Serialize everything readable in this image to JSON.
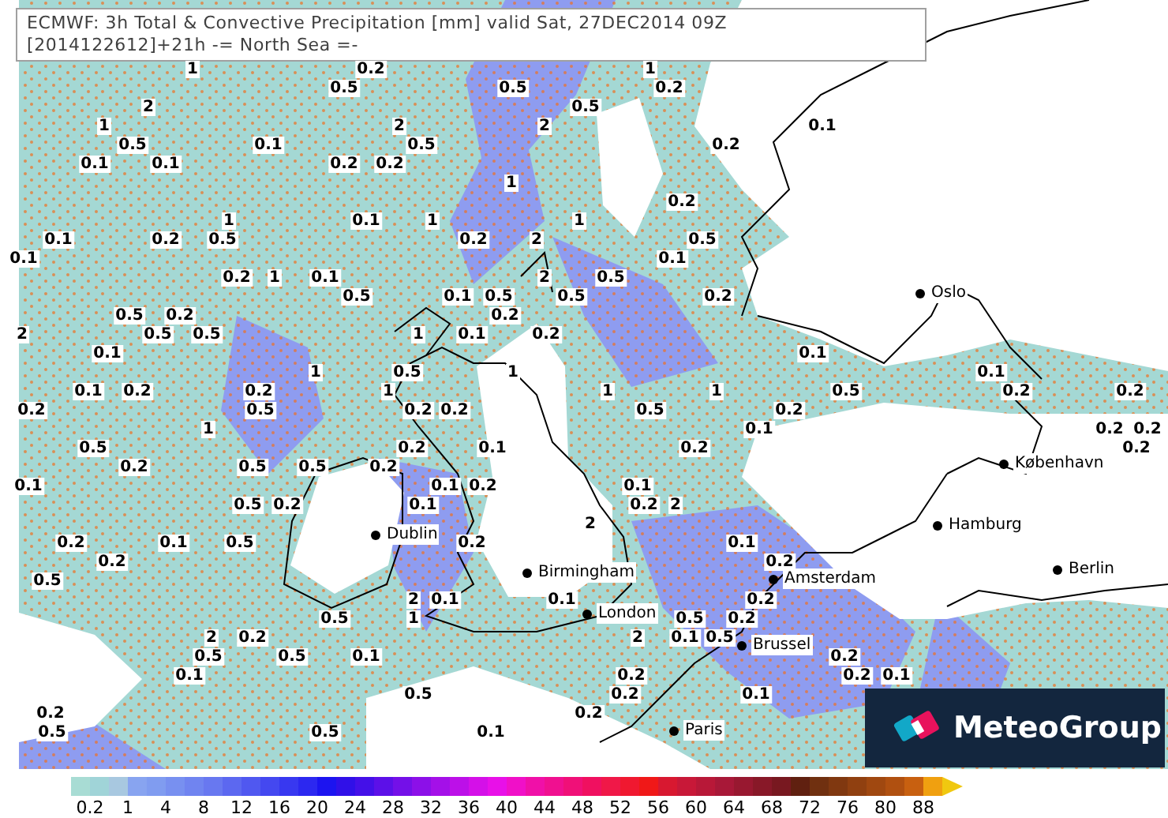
{
  "title": {
    "lines": [
      "ECMWF: 3h Total & Convective Precipitation [mm] valid Sat, 27DEC2014 09Z",
      "[2014122612]+21h -= North Sea =-"
    ]
  },
  "map": {
    "value_labels": [
      "1",
      "0.2",
      "1",
      "0.5",
      "0.5",
      "0.2",
      "2",
      "0.5",
      "1",
      "2",
      "2",
      "0.1",
      "0.5",
      "0.1",
      "0.5",
      "0.2",
      "0.1",
      "0.1",
      "0.2",
      "0.2",
      "1",
      "0.2",
      "1",
      "0.1",
      "1",
      "1",
      "0.1",
      "0.2",
      "0.5",
      "0.2",
      "2",
      "0.5",
      "0.1",
      "0.1",
      "0.2",
      "1",
      "0.1",
      "2",
      "0.5",
      "0.5",
      "0.1",
      "0.5",
      "0.5",
      "0.2",
      "0.5",
      "0.2",
      "0.2",
      "2",
      "0.5",
      "0.5",
      "1",
      "0.1",
      "0.2",
      "0.1",
      "0.1",
      "1",
      "0.5",
      "1",
      "0.1",
      "0.1",
      "0.2",
      "0.2",
      "1",
      "1",
      "1",
      "0.5",
      "0.2",
      "0.2",
      "0.2",
      "0.5",
      "0.2",
      "0.2",
      "0.5",
      "0.2",
      "1",
      "0.1",
      "0.2",
      "0.2",
      "0.5",
      "0.2",
      "0.1",
      "0.2",
      "0.2",
      "0.2",
      "0.5",
      "0.5",
      "0.2",
      "0.1",
      "0.1",
      "0.2",
      "0.1",
      "0.5",
      "0.2",
      "0.1",
      "0.2",
      "2",
      "2",
      "0.2",
      "0.1",
      "0.5",
      "0.2",
      "0.1",
      "0.2",
      "0.2",
      "0.5",
      "2",
      "0.1",
      "0.1",
      "0.2",
      "0.5",
      "1",
      "0.5",
      "0.2",
      "2",
      "0.2",
      "2",
      "0.1",
      "0.5",
      "0.5",
      "0.5",
      "0.1",
      "0.2",
      "0.1",
      "0.2",
      "0.2",
      "0.1",
      "0.5",
      "0.2",
      "0.1",
      "0.2",
      "0.2",
      "0.5",
      "0.5",
      "0.1"
    ],
    "cities": [
      {
        "name": "Oslo"
      },
      {
        "name": "København"
      },
      {
        "name": "Hamburg"
      },
      {
        "name": "Berlin"
      },
      {
        "name": "Dublin"
      },
      {
        "name": "Birmingham"
      },
      {
        "name": "London"
      },
      {
        "name": "Amsterdam"
      },
      {
        "name": "Brussel"
      },
      {
        "name": "Paris"
      }
    ]
  },
  "logo": {
    "text": "MeteoGroup"
  },
  "legend": {
    "swatches": [
      {
        "color": "#a8dcd4"
      },
      {
        "color": "#a0d4d8"
      },
      {
        "color": "#a8c8e0"
      },
      {
        "color": "#88a4f0"
      },
      {
        "color": "#809cf0"
      },
      {
        "color": "#7890f0"
      },
      {
        "color": "#7084f0"
      },
      {
        "color": "#6878f0"
      },
      {
        "color": "#5c68f0"
      },
      {
        "color": "#5058f0"
      },
      {
        "color": "#4448f0"
      },
      {
        "color": "#3838f0"
      },
      {
        "color": "#2c28f0"
      },
      {
        "color": "#1c14f0"
      },
      {
        "color": "#3010e8"
      },
      {
        "color": "#4410e8"
      },
      {
        "color": "#5c10e8"
      },
      {
        "color": "#7410e8"
      },
      {
        "color": "#8c10e8"
      },
      {
        "color": "#a410e8"
      },
      {
        "color": "#bc10e8"
      },
      {
        "color": "#d410e8"
      },
      {
        "color": "#e810e8"
      },
      {
        "color": "#f010c8"
      },
      {
        "color": "#f010a8"
      },
      {
        "color": "#f01090"
      },
      {
        "color": "#f01078"
      },
      {
        "color": "#f01060"
      },
      {
        "color": "#f01848"
      },
      {
        "color": "#f01830"
      },
      {
        "color": "#f01818"
      },
      {
        "color": "#d81830"
      },
      {
        "color": "#c81838"
      },
      {
        "color": "#b81838"
      },
      {
        "color": "#a81838"
      },
      {
        "color": "#981830"
      },
      {
        "color": "#881828"
      },
      {
        "color": "#781820"
      },
      {
        "color": "#602010"
      },
      {
        "color": "#703010"
      },
      {
        "color": "#803810"
      },
      {
        "color": "#904010"
      },
      {
        "color": "#a04810"
      },
      {
        "color": "#b05010"
      },
      {
        "color": "#c86010"
      },
      {
        "color": "#f0a010"
      }
    ],
    "ticks": [
      "0.2",
      "1",
      "4",
      "8",
      "12",
      "16",
      "20",
      "24",
      "28",
      "32",
      "36",
      "40",
      "44",
      "48",
      "52",
      "56",
      "60",
      "64",
      "68",
      "72",
      "76",
      "80",
      "88"
    ]
  }
}
